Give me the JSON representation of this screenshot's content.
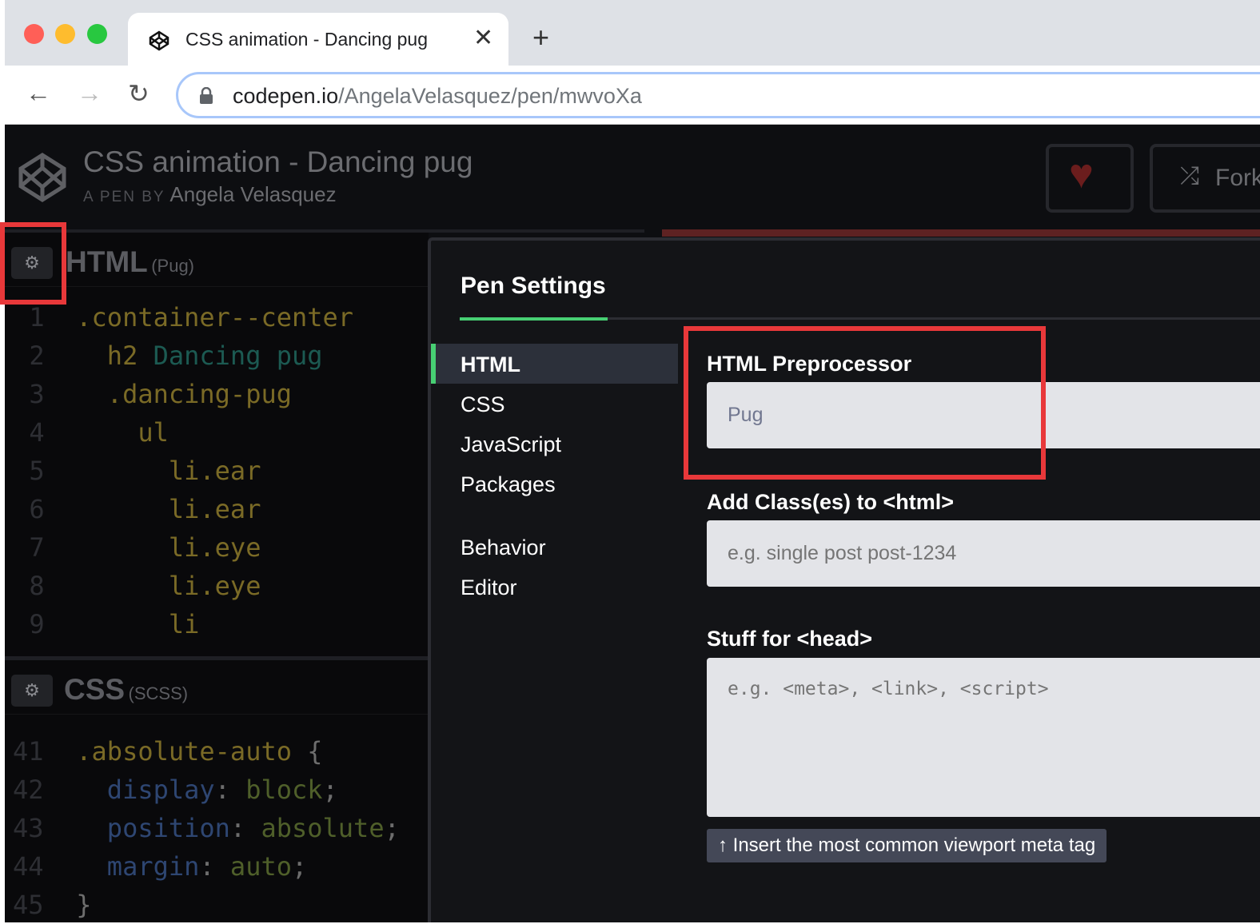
{
  "browser": {
    "tab_title": "CSS animation - Dancing pug",
    "url_host": "codepen.io",
    "url_path": "/AngelaVelasquez/pen/mwvoXa",
    "colors": {
      "close": "#ff5f57",
      "minimize": "#febc2e",
      "zoom": "#28c840"
    }
  },
  "header": {
    "title": "CSS animation - Dancing pug",
    "by_prefix": "A PEN BY",
    "author": "Angela Velasquez",
    "fork_label": "Fork"
  },
  "html_pane": {
    "name": "HTML",
    "sub": "(Pug)",
    "lines": [
      {
        "n": "1",
        "indent": "",
        "parts": [
          {
            "c": "y",
            "t": ".container--center"
          }
        ]
      },
      {
        "n": "2",
        "indent": "  ",
        "parts": [
          {
            "c": "y",
            "t": "h2 "
          },
          {
            "c": "t",
            "t": "Dancing pug"
          }
        ]
      },
      {
        "n": "3",
        "indent": "  ",
        "parts": [
          {
            "c": "y",
            "t": ".dancing-pug"
          }
        ]
      },
      {
        "n": "4",
        "indent": "    ",
        "parts": [
          {
            "c": "y",
            "t": "ul"
          }
        ]
      },
      {
        "n": "5",
        "indent": "      ",
        "parts": [
          {
            "c": "y",
            "t": "li.ear"
          }
        ]
      },
      {
        "n": "6",
        "indent": "      ",
        "parts": [
          {
            "c": "y",
            "t": "li.ear"
          }
        ]
      },
      {
        "n": "7",
        "indent": "      ",
        "parts": [
          {
            "c": "y",
            "t": "li.eye"
          }
        ]
      },
      {
        "n": "8",
        "indent": "      ",
        "parts": [
          {
            "c": "y",
            "t": "li.eye"
          }
        ]
      },
      {
        "n": "9",
        "indent": "      ",
        "parts": [
          {
            "c": "y",
            "t": "li"
          }
        ]
      }
    ]
  },
  "css_pane": {
    "name": "CSS",
    "sub": "(SCSS)",
    "lines": [
      {
        "n": "41",
        "indent": "",
        "parts": [
          {
            "c": "y",
            "t": ".absolute-auto "
          },
          {
            "c": "p",
            "t": "{"
          }
        ]
      },
      {
        "n": "42",
        "indent": "  ",
        "parts": [
          {
            "c": "b",
            "t": "display"
          },
          {
            "c": "p",
            "t": ": "
          },
          {
            "c": "g",
            "t": "block"
          },
          {
            "c": "p",
            "t": ";"
          }
        ]
      },
      {
        "n": "43",
        "indent": "  ",
        "parts": [
          {
            "c": "b",
            "t": "position"
          },
          {
            "c": "p",
            "t": ": "
          },
          {
            "c": "g",
            "t": "absolute"
          },
          {
            "c": "p",
            "t": ";"
          }
        ]
      },
      {
        "n": "44",
        "indent": "  ",
        "parts": [
          {
            "c": "b",
            "t": "margin"
          },
          {
            "c": "p",
            "t": ": "
          },
          {
            "c": "g",
            "t": "auto"
          },
          {
            "c": "p",
            "t": ";"
          }
        ]
      },
      {
        "n": "45",
        "indent": "",
        "parts": [
          {
            "c": "p",
            "t": "}"
          }
        ]
      }
    ]
  },
  "settings": {
    "title": "Pen Settings",
    "sidebar": [
      "HTML",
      "CSS",
      "JavaScript",
      "Packages",
      "Behavior",
      "Editor"
    ],
    "active": "HTML",
    "preprocessor_label": "HTML Preprocessor",
    "preprocessor_value": "Pug",
    "classes_label": "Add Class(es) to <html>",
    "classes_placeholder": "e.g. single post post-1234",
    "head_label": "Stuff for <head>",
    "head_placeholder": "e.g. <meta>, <link>, <script>",
    "viewport_button": "↑ Insert the most common viewport meta tag"
  },
  "colors": {
    "accent": "#47cf73",
    "highlight": "#e8383a",
    "heart": "#6b1d1d"
  }
}
